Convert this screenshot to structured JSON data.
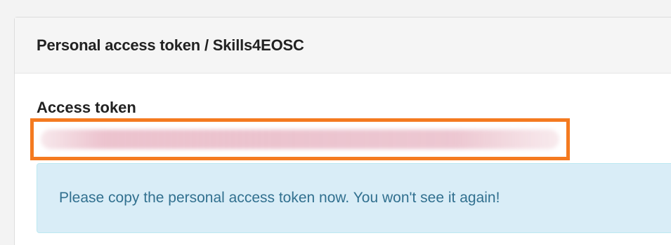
{
  "panel": {
    "title": "Personal access token / Skills4EOSC"
  },
  "token_field": {
    "label": "Access token",
    "value": "",
    "highlight_color": "#f47a20"
  },
  "notice": {
    "text": "Please copy the personal access token now. You won't see it again!",
    "background": "#d9edf7",
    "text_color": "#31708f"
  }
}
